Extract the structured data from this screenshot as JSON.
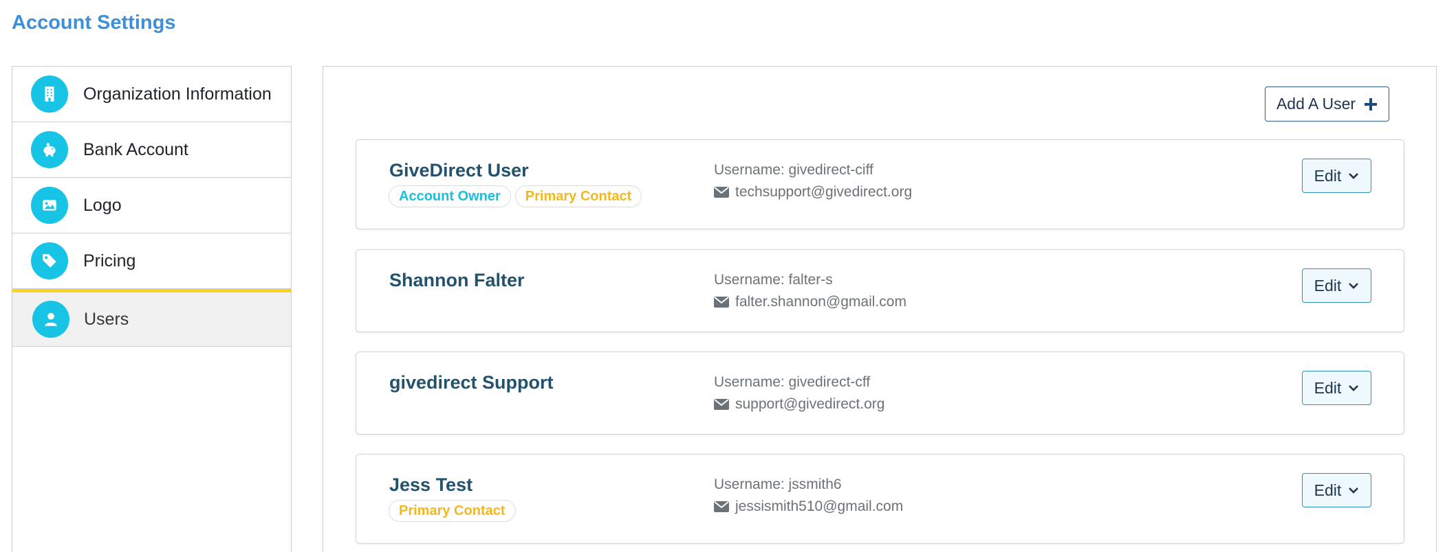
{
  "page": {
    "title": "Account Settings"
  },
  "sidebar": {
    "items": [
      {
        "label": "Organization Information",
        "icon": "building-icon"
      },
      {
        "label": "Bank Account",
        "icon": "piggy-bank-icon"
      },
      {
        "label": "Logo",
        "icon": "image-icon"
      },
      {
        "label": "Pricing",
        "icon": "tag-icon"
      },
      {
        "label": "Users",
        "icon": "user-icon",
        "active": true
      }
    ]
  },
  "main": {
    "add_user_label": "Add A User",
    "users": [
      {
        "name": "GiveDirect User",
        "badges": {
          "owner": "Account Owner",
          "primary": "Primary Contact"
        },
        "username": "Username: givedirect-ciff",
        "email": "techsupport@givedirect.org",
        "edit_label": "Edit"
      },
      {
        "name": "Shannon Falter",
        "username": "Username: falter-s",
        "email": "falter.shannon@gmail.com",
        "edit_label": "Edit"
      },
      {
        "name": "givedirect Support",
        "username": "Username: givedirect-cff",
        "email": "support@givedirect.org",
        "edit_label": "Edit"
      },
      {
        "name": "Jess Test",
        "badges": {
          "primary": "Primary Contact"
        },
        "username": "Username: jssmith6",
        "email": "jessismith510@gmail.com",
        "edit_label": "Edit"
      }
    ]
  },
  "colors": {
    "title": "#3d8fd8",
    "icon_bg": "#17c4e6",
    "active_bar": "#ffd21f",
    "owner_badge": "#17c0e0",
    "primary_badge": "#f3b81d",
    "user_name": "#23526e"
  }
}
